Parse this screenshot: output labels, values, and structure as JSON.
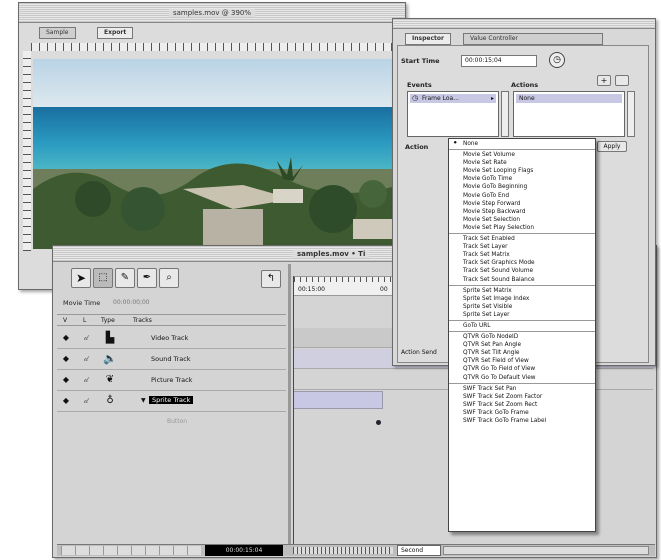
{
  "preview_window": {
    "title": "samples.mov @ 390%",
    "tabs": [
      "Sample",
      "Export"
    ]
  },
  "inspector": {
    "tabs": [
      "Inspector",
      "Value Controller"
    ],
    "start_time_label": "Start Time",
    "start_time_value": "00:00:15;04",
    "events_label": "Events",
    "actions_label": "Actions",
    "event_item": "Frame Loa...",
    "action_item": "None",
    "action_label": "Action",
    "apply_label": "Apply",
    "add_symbol": "+",
    "action_send_label": "Action Send"
  },
  "action_menu": {
    "groups": [
      [
        "None"
      ],
      [
        "Movie Set Volume",
        "Movie Set Rate",
        "Movie Set Looping Flags",
        "Movie GoTo Time",
        "Movie GoTo Beginning",
        "Movie GoTo End",
        "Movie Step Forward",
        "Movie Step Backward",
        "Movie Set Selection",
        "Movie Set Play Selection"
      ],
      [
        "Track Set Enabled",
        "Track Set Layer",
        "Track Set Matrix",
        "Track Set Graphics Mode",
        "Track Set Sound Volume",
        "Track Set Sound Balance"
      ],
      [
        "Sprite Set Matrix",
        "Sprite Set Image Index",
        "Sprite Set Visible",
        "Sprite Set Layer"
      ],
      [
        "GoTo URL"
      ],
      [
        "QTVR GoTo NodeID",
        "QTVR Set Pan Angle",
        "QTVR Set Tilt Angle",
        "QTVR Set Field of View",
        "QTVR Go To Field of View",
        "QTVR Go To Default View"
      ],
      [
        "SWF Track Set Pan",
        "SWF Track Set Zoom Factor",
        "SWF Track Set Zoom Rect",
        "SWF Track GoTo Frame",
        "SWF Track GoTo Frame Label"
      ]
    ],
    "checked_index": 0
  },
  "timeline": {
    "title": "samples.mov • Ti",
    "move_time_label": "Movie Time",
    "move_time_value": "00:00:00;00",
    "columns": [
      "V",
      "L",
      "Type",
      "Tracks"
    ],
    "tracks": [
      {
        "name": "Video Track",
        "type_icon": "film-icon"
      },
      {
        "name": "Sound Track",
        "type_icon": "speaker-icon"
      },
      {
        "name": "Picture Track",
        "type_icon": "picture-icon"
      },
      {
        "name": "Sprite Track",
        "type_icon": "sprite-icon",
        "selected": true
      }
    ],
    "sub_row_label": "Button",
    "ruler_time_1": "00:15:00",
    "ruler_time_2": "00",
    "footer_time": "00:00:15:04",
    "footer_unit": "Second"
  },
  "colors": {
    "panel": "#dcdcdc",
    "selection": "#000000",
    "track_bar": "#c8c8e4",
    "menu_bg": "#ffffff"
  }
}
